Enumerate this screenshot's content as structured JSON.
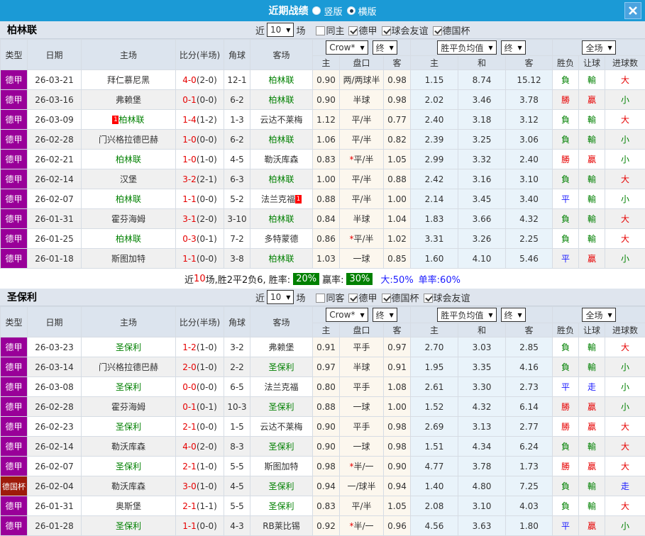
{
  "titlebar": {
    "title": "近期战绩",
    "radios": [
      {
        "label": "竖版",
        "checked": false
      },
      {
        "label": "横版",
        "checked": true
      }
    ],
    "close_icon": "X"
  },
  "columns": [
    "类型",
    "日期",
    "主场",
    "比分(半场)",
    "角球",
    "客场",
    "主",
    "盘口",
    "客",
    "主",
    "和",
    "客",
    "胜负",
    "让球",
    "进球数"
  ],
  "sections": [
    {
      "team": "柏林联",
      "near_label": "近",
      "games_count": "10",
      "games_suffix": "场",
      "checkboxes": [
        {
          "label": "同主",
          "checked": false
        },
        {
          "label": "德甲",
          "checked": true
        },
        {
          "label": "球会友谊",
          "checked": true
        },
        {
          "label": "德国杯",
          "checked": true
        }
      ],
      "dropdowns": {
        "odds_company": "Crow*",
        "odds_time": "终",
        "avg_label": "胜平负均值",
        "avg_time": "终",
        "scope": "全场"
      },
      "rows": [
        {
          "type": "德甲",
          "cup": false,
          "date": "26-03-21",
          "home": {
            "name": "拜仁慕尼黑",
            "focus": false
          },
          "score": "4-0",
          "half": "(2-0)",
          "corner": "12-1",
          "away": {
            "name": "柏林联",
            "focus": true
          },
          "handicap": [
            "0.90",
            "两/两球半",
            "0.98"
          ],
          "avg": [
            "1.15",
            "8.74",
            "15.12"
          ],
          "results": [
            "負",
            "輸",
            "大"
          ]
        },
        {
          "type": "德甲",
          "cup": false,
          "date": "26-03-16",
          "home": {
            "name": "弗赖堡",
            "focus": false
          },
          "score": "0-1",
          "half": "(0-0)",
          "corner": "6-2",
          "away": {
            "name": "柏林联",
            "focus": true
          },
          "handicap": [
            "0.90",
            "半球",
            "0.98"
          ],
          "avg": [
            "2.02",
            "3.46",
            "3.78"
          ],
          "results": [
            "勝",
            "贏",
            "小"
          ]
        },
        {
          "type": "德甲",
          "cup": false,
          "date": "26-03-09",
          "home": {
            "name": "柏林联",
            "focus": true,
            "badge": "1",
            "badge_side": "left"
          },
          "score": "1-4",
          "half": "(1-2)",
          "corner": "1-3",
          "away": {
            "name": "云达不莱梅",
            "focus": false
          },
          "handicap": [
            "1.12",
            "平/半",
            "0.77"
          ],
          "avg": [
            "2.40",
            "3.18",
            "3.12"
          ],
          "results": [
            "負",
            "輸",
            "大"
          ]
        },
        {
          "type": "德甲",
          "cup": false,
          "date": "26-02-28",
          "home": {
            "name": "门兴格拉德巴赫",
            "focus": false
          },
          "score": "1-0",
          "half": "(0-0)",
          "corner": "6-2",
          "away": {
            "name": "柏林联",
            "focus": true
          },
          "handicap": [
            "1.06",
            "平/半",
            "0.82"
          ],
          "avg": [
            "2.39",
            "3.25",
            "3.06"
          ],
          "results": [
            "負",
            "輸",
            "小"
          ]
        },
        {
          "type": "德甲",
          "cup": false,
          "date": "26-02-21",
          "home": {
            "name": "柏林联",
            "focus": true
          },
          "score": "1-0",
          "half": "(1-0)",
          "corner": "4-5",
          "away": {
            "name": "勒沃库森",
            "focus": false
          },
          "handicap": [
            "0.83",
            "*平/半",
            "1.05"
          ],
          "avg": [
            "2.99",
            "3.32",
            "2.40"
          ],
          "results": [
            "勝",
            "贏",
            "小"
          ]
        },
        {
          "type": "德甲",
          "cup": false,
          "date": "26-02-14",
          "home": {
            "name": "汉堡",
            "focus": false
          },
          "score": "3-2",
          "half": "(2-1)",
          "corner": "6-3",
          "away": {
            "name": "柏林联",
            "focus": true
          },
          "handicap": [
            "1.00",
            "平/半",
            "0.88"
          ],
          "avg": [
            "2.42",
            "3.16",
            "3.10"
          ],
          "results": [
            "負",
            "輸",
            "大"
          ]
        },
        {
          "type": "德甲",
          "cup": false,
          "date": "26-02-07",
          "home": {
            "name": "柏林联",
            "focus": true
          },
          "score": "1-1",
          "half": "(0-0)",
          "corner": "5-2",
          "away": {
            "name": "法兰克福",
            "focus": false,
            "badge": "1",
            "badge_side": "right"
          },
          "handicap": [
            "0.88",
            "平/半",
            "1.00"
          ],
          "avg": [
            "2.14",
            "3.45",
            "3.40"
          ],
          "results": [
            "平",
            "輸",
            "小"
          ]
        },
        {
          "type": "德甲",
          "cup": false,
          "date": "26-01-31",
          "home": {
            "name": "霍芬海姆",
            "focus": false
          },
          "score": "3-1",
          "half": "(2-0)",
          "corner": "3-10",
          "away": {
            "name": "柏林联",
            "focus": true
          },
          "handicap": [
            "0.84",
            "半球",
            "1.04"
          ],
          "avg": [
            "1.83",
            "3.66",
            "4.32"
          ],
          "results": [
            "負",
            "輸",
            "大"
          ]
        },
        {
          "type": "德甲",
          "cup": false,
          "date": "26-01-25",
          "home": {
            "name": "柏林联",
            "focus": true
          },
          "score": "0-3",
          "half": "(0-1)",
          "corner": "7-2",
          "away": {
            "name": "多特蒙德",
            "focus": false
          },
          "handicap": [
            "0.86",
            "*平/半",
            "1.02"
          ],
          "avg": [
            "3.31",
            "3.26",
            "2.25"
          ],
          "results": [
            "負",
            "輸",
            "大"
          ]
        },
        {
          "type": "德甲",
          "cup": false,
          "date": "26-01-18",
          "home": {
            "name": "斯图加特",
            "focus": false
          },
          "score": "1-1",
          "half": "(0-0)",
          "corner": "3-8",
          "away": {
            "name": "柏林联",
            "focus": true
          },
          "handicap": [
            "1.03",
            "一球",
            "0.85"
          ],
          "avg": [
            "1.60",
            "4.10",
            "5.46"
          ],
          "results": [
            "平",
            "贏",
            "小"
          ]
        }
      ],
      "summary": [
        {
          "text": "近",
          "style": "plain"
        },
        {
          "text": "10",
          "style": "red"
        },
        {
          "text": "场,胜2平2负6, 胜率:",
          "style": "plain"
        },
        {
          "text": "20%",
          "style": "badge"
        },
        {
          "text": "赢率:",
          "style": "plain"
        },
        {
          "text": "30%",
          "style": "badge"
        },
        {
          "text": "大:50%",
          "style": "blue"
        },
        {
          "text": "单率:60%",
          "style": "blue"
        }
      ]
    },
    {
      "team": "圣保利",
      "near_label": "近",
      "games_count": "10",
      "games_suffix": "场",
      "checkboxes": [
        {
          "label": "同客",
          "checked": false
        },
        {
          "label": "德甲",
          "checked": true
        },
        {
          "label": "德国杯",
          "checked": true
        },
        {
          "label": "球会友谊",
          "checked": true
        }
      ],
      "dropdowns": {
        "odds_company": "Crow*",
        "odds_time": "终",
        "avg_label": "胜平负均值",
        "avg_time": "终",
        "scope": "全场"
      },
      "rows": [
        {
          "type": "德甲",
          "cup": false,
          "date": "26-03-23",
          "home": {
            "name": "圣保利",
            "focus": true
          },
          "score": "1-2",
          "half": "(1-0)",
          "corner": "3-2",
          "away": {
            "name": "弗赖堡",
            "focus": false
          },
          "handicap": [
            "0.91",
            "平手",
            "0.97"
          ],
          "avg": [
            "2.70",
            "3.03",
            "2.85"
          ],
          "results": [
            "負",
            "輸",
            "大"
          ]
        },
        {
          "type": "德甲",
          "cup": false,
          "date": "26-03-14",
          "home": {
            "name": "门兴格拉德巴赫",
            "focus": false
          },
          "score": "2-0",
          "half": "(1-0)",
          "corner": "2-2",
          "away": {
            "name": "圣保利",
            "focus": true
          },
          "handicap": [
            "0.97",
            "半球",
            "0.91"
          ],
          "avg": [
            "1.95",
            "3.35",
            "4.16"
          ],
          "results": [
            "負",
            "輸",
            "小"
          ]
        },
        {
          "type": "德甲",
          "cup": false,
          "date": "26-03-08",
          "home": {
            "name": "圣保利",
            "focus": true
          },
          "score": "0-0",
          "half": "(0-0)",
          "corner": "6-5",
          "away": {
            "name": "法兰克福",
            "focus": false
          },
          "handicap": [
            "0.80",
            "平手",
            "1.08"
          ],
          "avg": [
            "2.61",
            "3.30",
            "2.73"
          ],
          "results": [
            "平",
            "走",
            "小"
          ]
        },
        {
          "type": "德甲",
          "cup": false,
          "date": "26-02-28",
          "home": {
            "name": "霍芬海姆",
            "focus": false
          },
          "score": "0-1",
          "half": "(0-1)",
          "corner": "10-3",
          "away": {
            "name": "圣保利",
            "focus": true
          },
          "handicap": [
            "0.88",
            "一球",
            "1.00"
          ],
          "avg": [
            "1.52",
            "4.32",
            "6.14"
          ],
          "results": [
            "勝",
            "贏",
            "小"
          ]
        },
        {
          "type": "德甲",
          "cup": false,
          "date": "26-02-23",
          "home": {
            "name": "圣保利",
            "focus": true
          },
          "score": "2-1",
          "half": "(0-0)",
          "corner": "1-5",
          "away": {
            "name": "云达不莱梅",
            "focus": false
          },
          "handicap": [
            "0.90",
            "平手",
            "0.98"
          ],
          "avg": [
            "2.69",
            "3.13",
            "2.77"
          ],
          "results": [
            "勝",
            "贏",
            "大"
          ]
        },
        {
          "type": "德甲",
          "cup": false,
          "date": "26-02-14",
          "home": {
            "name": "勒沃库森",
            "focus": false
          },
          "score": "4-0",
          "half": "(2-0)",
          "corner": "8-3",
          "away": {
            "name": "圣保利",
            "focus": true
          },
          "handicap": [
            "0.90",
            "一球",
            "0.98"
          ],
          "avg": [
            "1.51",
            "4.34",
            "6.24"
          ],
          "results": [
            "負",
            "輸",
            "大"
          ]
        },
        {
          "type": "德甲",
          "cup": false,
          "date": "26-02-07",
          "home": {
            "name": "圣保利",
            "focus": true
          },
          "score": "2-1",
          "half": "(1-0)",
          "corner": "5-5",
          "away": {
            "name": "斯图加特",
            "focus": false
          },
          "handicap": [
            "0.98",
            "*半/一",
            "0.90"
          ],
          "avg": [
            "4.77",
            "3.78",
            "1.73"
          ],
          "results": [
            "勝",
            "贏",
            "大"
          ]
        },
        {
          "type": "德国杯",
          "cup": true,
          "date": "26-02-04",
          "home": {
            "name": "勒沃库森",
            "focus": false
          },
          "score": "3-0",
          "half": "(1-0)",
          "corner": "4-5",
          "away": {
            "name": "圣保利",
            "focus": true
          },
          "handicap": [
            "0.94",
            "一/球半",
            "0.94"
          ],
          "avg": [
            "1.40",
            "4.80",
            "7.25"
          ],
          "results": [
            "負",
            "輸",
            "走"
          ]
        },
        {
          "type": "德甲",
          "cup": false,
          "date": "26-01-31",
          "home": {
            "name": "奥斯堡",
            "focus": false
          },
          "score": "2-1",
          "half": "(1-1)",
          "corner": "5-5",
          "away": {
            "name": "圣保利",
            "focus": true
          },
          "handicap": [
            "0.83",
            "平/半",
            "1.05"
          ],
          "avg": [
            "2.08",
            "3.10",
            "4.03"
          ],
          "results": [
            "負",
            "輸",
            "大"
          ]
        },
        {
          "type": "德甲",
          "cup": false,
          "date": "26-01-28",
          "home": {
            "name": "圣保利",
            "focus": true
          },
          "score": "1-1",
          "half": "(0-0)",
          "corner": "4-3",
          "away": {
            "name": "RB莱比锡",
            "focus": false
          },
          "handicap": [
            "0.92",
            "*半/一",
            "0.96"
          ],
          "avg": [
            "4.56",
            "3.63",
            "1.80"
          ],
          "results": [
            "平",
            "贏",
            "小"
          ]
        }
      ],
      "summary": null
    }
  ]
}
